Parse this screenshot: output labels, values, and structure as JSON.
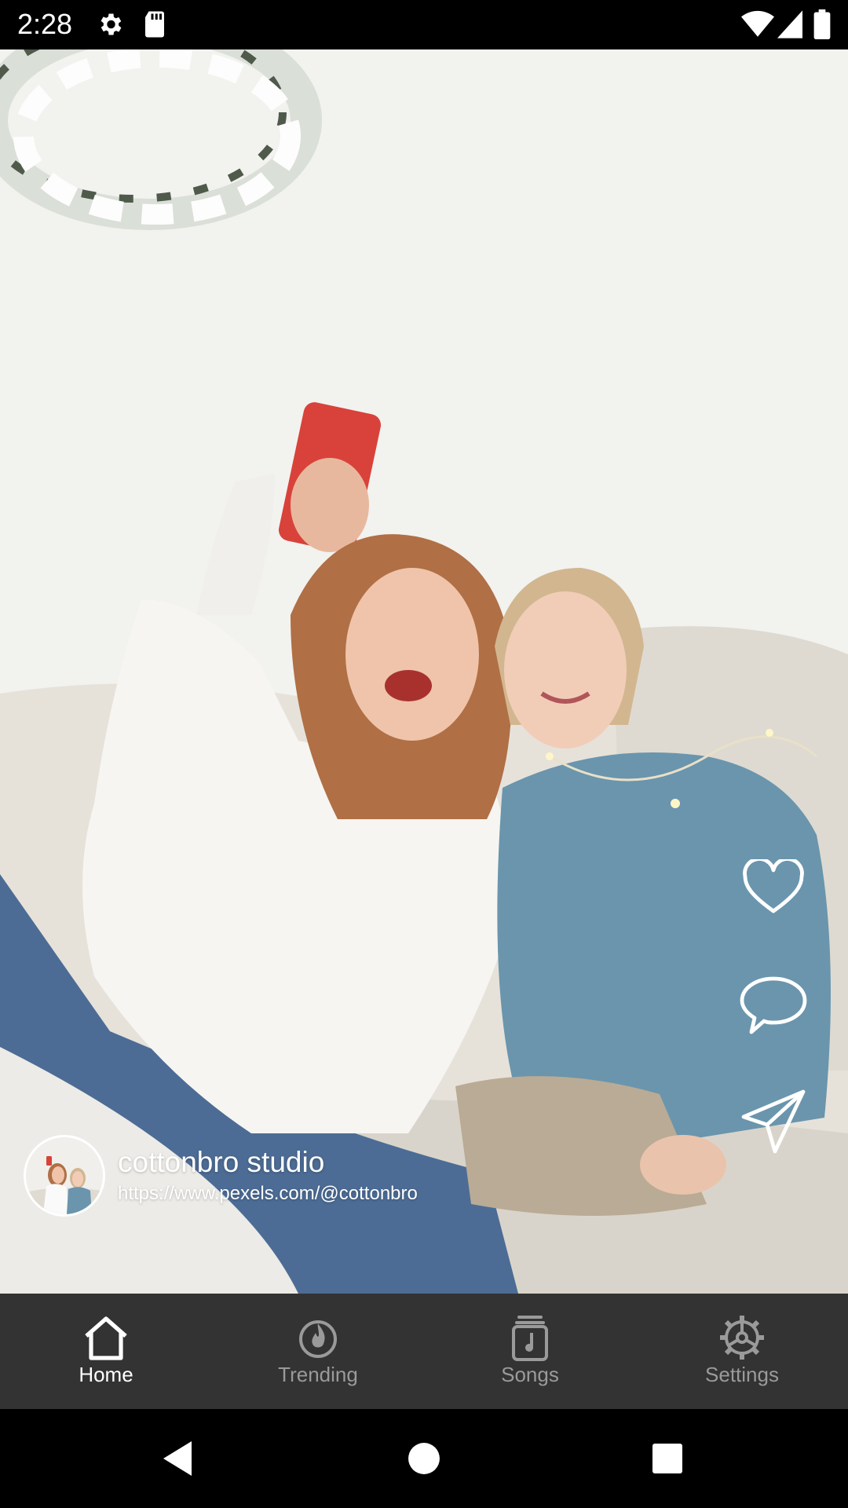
{
  "status_bar": {
    "time": "2:28",
    "icons": [
      "settings-gear-icon",
      "sd-card-icon",
      "wifi-icon",
      "cellular-signal-icon",
      "battery-icon"
    ]
  },
  "video": {
    "description_icon": "video-frame",
    "actions": [
      {
        "name": "like",
        "icon": "heart-icon"
      },
      {
        "name": "comment",
        "icon": "comment-bubble-icon"
      },
      {
        "name": "share",
        "icon": "send-icon"
      }
    ]
  },
  "author": {
    "name": "cottonbro studio",
    "link": "https://www.pexels.com/@cottonbro"
  },
  "bottom_nav": {
    "items": [
      {
        "label": "Home",
        "icon": "home-icon",
        "active": true
      },
      {
        "label": "Trending",
        "icon": "flame-icon",
        "active": false
      },
      {
        "label": "Songs",
        "icon": "music-note-icon",
        "active": false
      },
      {
        "label": "Settings",
        "icon": "gear-icon",
        "active": false
      }
    ],
    "colors": {
      "background": "#333333",
      "active": "#ffffff",
      "inactive": "#9a9a9a"
    }
  },
  "system_nav": {
    "buttons": [
      "back-icon",
      "home-circle-icon",
      "recents-square-icon"
    ]
  }
}
